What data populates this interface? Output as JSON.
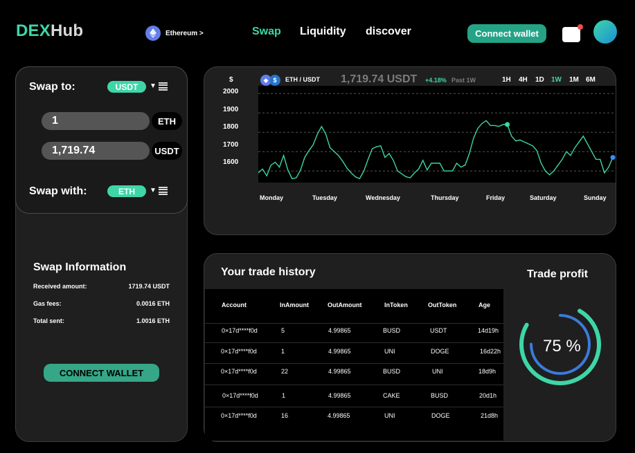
{
  "header": {
    "logo_part1": "DEX",
    "logo_part2": "Hub",
    "network": "Ethereum >",
    "nav": {
      "swap": "Swap",
      "liquidity": "Liquidity",
      "discover": "discover"
    },
    "connect_wallet": "Connect wallet"
  },
  "swap": {
    "to_label": "Swap to:",
    "to_token": "USDT",
    "amount1": "1",
    "unit1": "ETH",
    "amount2": "1,719.74",
    "unit2": "USDT",
    "with_label": "Swap with:",
    "with_token": "ETH"
  },
  "info": {
    "title": "Swap Information",
    "rows": [
      {
        "label": "Received amount:",
        "value": "1719.74 USDT"
      },
      {
        "label": "Gas fees:",
        "value": "0.0016 ETH"
      },
      {
        "label": "Total sent:",
        "value": "1.0016 ETH"
      }
    ],
    "connect_button": "CONNECT WALLET"
  },
  "chart_header": {
    "pair": "ETH / USDT",
    "price": "1,719.74 USDT",
    "change": "+4.18%",
    "period": "Past 1W",
    "timeframes": [
      "1H",
      "4H",
      "1D",
      "1W",
      "1M",
      "6M"
    ],
    "active_timeframe": "1W",
    "colors": {
      "line": "#3ed6a7",
      "accent": "#3ed6a7"
    }
  },
  "chart_data": {
    "type": "line",
    "ylabel": "$",
    "ylim": [
      1540,
      2040
    ],
    "yticks": [
      2000,
      1900,
      1800,
      1700,
      1600
    ],
    "categories": [
      "Monday",
      "Tuesday",
      "Wednesday",
      "Thursday",
      "Friday",
      "Saturday",
      "Sunday"
    ],
    "grid": true,
    "series": [
      {
        "values": [
          1590,
          1610,
          1575,
          1630,
          1645,
          1620,
          1680,
          1605,
          1560,
          1565,
          1605,
          1670,
          1705,
          1735,
          1790,
          1830,
          1790,
          1720,
          1700,
          1680,
          1650,
          1615,
          1590,
          1570,
          1560,
          1600,
          1660,
          1715,
          1725,
          1730,
          1670,
          1690,
          1655,
          1600,
          1585,
          1570,
          1565,
          1590,
          1610,
          1655,
          1605,
          1640,
          1640,
          1640,
          1600,
          1600,
          1600,
          1640,
          1620,
          1630,
          1690,
          1770,
          1820,
          1845,
          1860,
          1835,
          1835,
          1830,
          1840,
          1840,
          1780,
          1755,
          1760,
          1750,
          1740,
          1730,
          1705,
          1640,
          1600,
          1580,
          1600,
          1630,
          1660,
          1700,
          1680,
          1720,
          1750,
          1780,
          1740,
          1700,
          1660,
          1660,
          1590,
          1620,
          1670
        ]
      }
    ]
  },
  "history": {
    "title": "Your trade history",
    "columns": [
      "Account",
      "InAmount",
      "OutAmount",
      "InToken",
      "OutToken",
      "Age"
    ],
    "rows": [
      [
        "0×17d****f0d",
        "5",
        "4.99865",
        "BUSD",
        "USDT",
        "14d19h"
      ],
      [
        "0×17d****f0d",
        "1",
        "4.99865",
        "UNI",
        "DOGE",
        "16d22h"
      ],
      [
        "0×17d****f0d",
        "22",
        "4.99865",
        "BUSD",
        "UNI",
        "18d9h"
      ],
      [
        "0×17d****f0d",
        "1",
        "4.99865",
        "CAKE",
        "BUSD",
        "20d1h"
      ],
      [
        "0×17d****f0d",
        "16",
        "4.99865",
        "UNI",
        "DOGE",
        "21d8h"
      ]
    ]
  },
  "profit": {
    "title": "Trade profit",
    "value_text": "75 %",
    "percent": 75
  }
}
